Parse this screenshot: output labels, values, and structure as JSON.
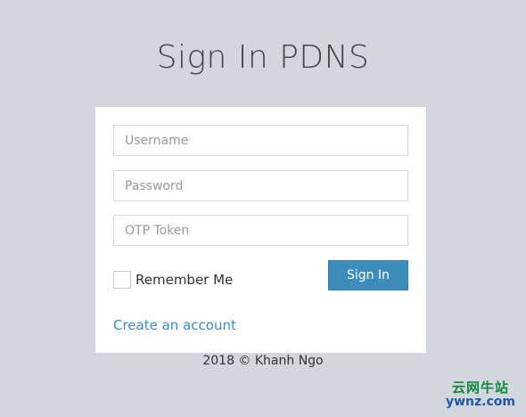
{
  "page": {
    "title": "Sign In PDNS",
    "footer": "2018 © Khanh Ngo"
  },
  "form": {
    "username_placeholder": "Username",
    "password_placeholder": "Password",
    "otp_placeholder": "OTP Token",
    "remember_label": "Remember Me",
    "remember_checked": false,
    "signin_label": "Sign In",
    "create_account_label": "Create an account"
  },
  "watermark": {
    "line1": "云网牛站",
    "line2": "ywnz.com"
  },
  "colors": {
    "background": "#d2d6de",
    "primary": "#3c8dbc",
    "panel": "#ffffff"
  }
}
